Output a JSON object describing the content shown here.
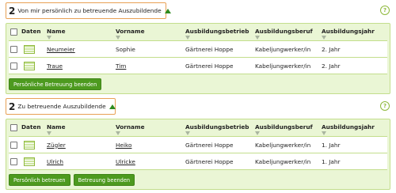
{
  "section1": {
    "count": "2",
    "title": "Von mir persönlich zu betreuende Auszubildende",
    "headers": [
      "Daten",
      "Name",
      "Vorname",
      "Ausbildungsbetrieb",
      "Ausbildungsberuf",
      "Ausbildungsjahr"
    ],
    "rows": [
      {
        "name": "Neumeier",
        "vorname": "Sophie",
        "betrieb": "Gärtnerei Hoppe",
        "beruf": "Kabeljungwerker/in",
        "jahr": "2. Jahr"
      },
      {
        "name": "Traue",
        "vorname": "Tim",
        "betrieb": "Gärtnerei Hoppe",
        "beruf": "Kabeljungwerker/in",
        "jahr": "2. Jahr"
      }
    ],
    "buttons": [
      "Persönliche Betreuung beenden"
    ]
  },
  "section2": {
    "count": "2",
    "title": "Zu betreuende Auszubildende",
    "headers": [
      "Daten",
      "Name",
      "Vorname",
      "Ausbildungsbetrieb",
      "Ausbildungsberuf",
      "Ausbildungsjahr"
    ],
    "rows": [
      {
        "name": "Zügler",
        "vorname": "Heiko",
        "betrieb": "Gärtnerei Hoppe",
        "beruf": "Kabeljungwerker/in",
        "jahr": "1. Jahr"
      },
      {
        "name": "Ulrich",
        "vorname": "Ulricke",
        "betrieb": "Gärtnerei Hoppe",
        "beruf": "Kabeljungwerker/in",
        "jahr": "1. Jahr"
      }
    ],
    "buttons": [
      "Persönlich betreuen",
      "Betreuung beenden"
    ]
  },
  "help_glyph": "?",
  "colors": {
    "accent": "#4d9a1f",
    "panel": "#eaf6d5",
    "title_border": "#e8a155"
  }
}
